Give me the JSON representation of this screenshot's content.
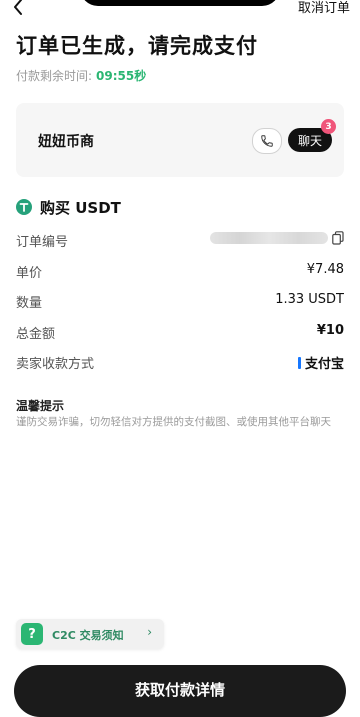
{
  "header": {
    "cancel_label": "取消订单",
    "title": "订单已生成，请完成支付"
  },
  "countdown": {
    "label": "付款剩余时间:",
    "time": "09:55秒"
  },
  "merchant": {
    "name": "妞妞币商",
    "chat_label": "聊天",
    "unread_count": "3"
  },
  "order": {
    "heading": "购买 USDT",
    "rows": [
      {
        "label": "订单编号",
        "value": ""
      },
      {
        "label": "单价",
        "value": "¥7.48"
      },
      {
        "label": "数量",
        "value": "1.33 USDT"
      },
      {
        "label": "总金额",
        "value": "¥10"
      },
      {
        "label": "卖家收款方式",
        "value": "支付宝"
      }
    ]
  },
  "tips": {
    "title": "温馨提示",
    "text": "谨防交易诈骗，切勿轻信对方提供的支付截图、或使用其他平台聊天"
  },
  "c2c_notice": {
    "label": "C2C 交易须知"
  },
  "action": {
    "label": "获取付款详情"
  },
  "colors": {
    "accent_green": "#2bb673",
    "badge_pink": "#f0557a",
    "alipay_blue": "#1677ff",
    "button_dark": "#1b1b1b"
  },
  "icons": [
    "back-arrow-icon",
    "phone-icon",
    "tether-icon",
    "copy-icon",
    "question-icon",
    "chevron-right-icon"
  ]
}
